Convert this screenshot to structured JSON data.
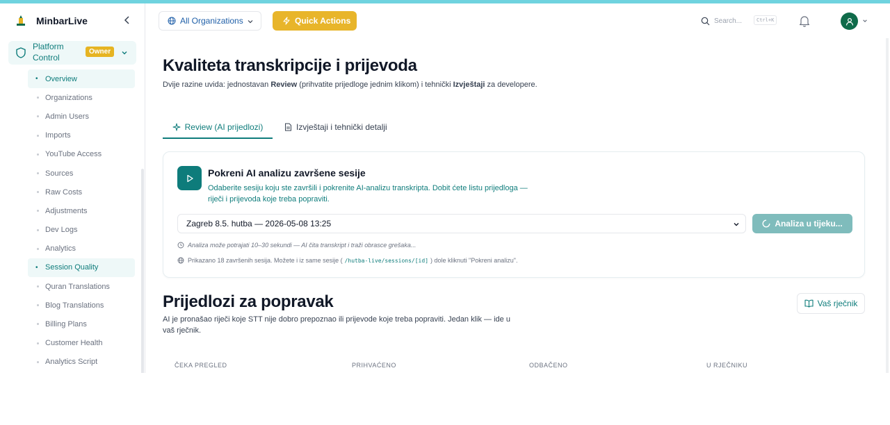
{
  "brand": {
    "name": "MinbarLive"
  },
  "sidebar": {
    "section_label": "Platform Control",
    "badge": "Owner",
    "items": [
      {
        "label": "Overview",
        "active": true
      },
      {
        "label": "Organizations",
        "active": false
      },
      {
        "label": "Admin Users",
        "active": false
      },
      {
        "label": "Imports",
        "active": false
      },
      {
        "label": "YouTube Access",
        "active": false
      },
      {
        "label": "Sources",
        "active": false
      },
      {
        "label": "Raw Costs",
        "active": false
      },
      {
        "label": "Adjustments",
        "active": false
      },
      {
        "label": "Dev Logs",
        "active": false
      },
      {
        "label": "Analytics",
        "active": false
      },
      {
        "label": "Session Quality",
        "active": true
      },
      {
        "label": "Quran Translations",
        "active": false
      },
      {
        "label": "Blog Translations",
        "active": false
      },
      {
        "label": "Billing Plans",
        "active": false
      },
      {
        "label": "Customer Health",
        "active": false
      },
      {
        "label": "Analytics Script",
        "active": false
      }
    ]
  },
  "header": {
    "org_select": "All Organizations",
    "quick_actions": "Quick Actions",
    "search_placeholder": "Search...",
    "search_shortcut": "Ctrl+K"
  },
  "page": {
    "title": "Kvaliteta transkripcije i prijevoda",
    "subtitle_pre": "Dvije razine uvida: jednostavan ",
    "subtitle_b1": "Review",
    "subtitle_mid": " (prihvatite prijedloge jednim klikom) i tehnički ",
    "subtitle_b2": "Izvještaji",
    "subtitle_post": " za developere."
  },
  "tabs": [
    {
      "label": "Review (AI prijedlozi)",
      "active": true
    },
    {
      "label": "Izvještaji i tehnički detalji",
      "active": false
    }
  ],
  "analysis_card": {
    "title": "Pokreni AI analizu završene sesije",
    "description": "Odaberite sesiju koju ste završili i pokrenite AI-analizu transkripta. Dobit ćete listu prijedloga — riječi i prijevoda koje treba popraviti.",
    "selected_session": "Zagreb 8.5. hutba — 2026-05-08 13:25",
    "button_label": "Analiza u tijeku...",
    "hint_time": "Analiza može potrajati 10–30 sekundi — AI čita transkript i traži obrasce grešaka...",
    "hint_count_pre": "Prikazano 18 završenih sesija. Možete i iz same sesije (",
    "hint_code": "/hutba-live/sessions/[id]",
    "hint_count_post": ") dole kliknuti \"Pokreni analizu\"."
  },
  "suggestions": {
    "title": "Prijedlozi za popravak",
    "description": "AI je pronašao riječi koje STT nije dobro prepoznao ili prijevode koje treba popraviti. Jedan klik — ide u vaš rječnik.",
    "dictionary_button": "Vaš rječnik",
    "stats": [
      {
        "label": "ČEKA PREGLED"
      },
      {
        "label": "PRIHVAĆENO"
      },
      {
        "label": "ODBAČENO"
      },
      {
        "label": "U RJEČNIKU"
      }
    ]
  },
  "colors": {
    "accent": "#0e7c7b",
    "quick_actions": "#e8b52a",
    "badge": "#e6b422"
  }
}
